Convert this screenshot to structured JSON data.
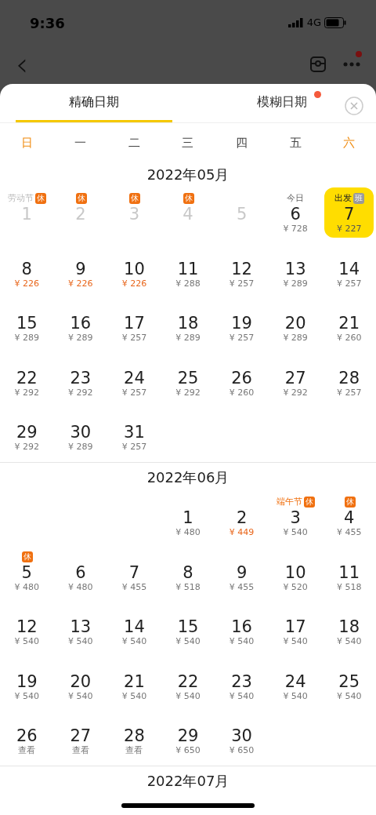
{
  "status_bar": {
    "time": "9:36",
    "network": "4G"
  },
  "nav": {
    "back_icon": "‹",
    "has_notification": true
  },
  "tabs": [
    {
      "label": "精确日期",
      "selected": true,
      "badge": false
    },
    {
      "label": "模糊日期",
      "selected": false,
      "badge": true
    }
  ],
  "weekdays": [
    {
      "label": "日",
      "weekend": true
    },
    {
      "label": "一",
      "weekend": false
    },
    {
      "label": "二",
      "weekend": false
    },
    {
      "label": "三",
      "weekend": false
    },
    {
      "label": "四",
      "weekend": false
    },
    {
      "label": "五",
      "weekend": false
    },
    {
      "label": "六",
      "weekend": true
    }
  ],
  "months": [
    {
      "title": "2022年05月",
      "weeks": [
        [
          {
            "kind": "day",
            "day": "1",
            "note": "劳动节",
            "tag": {
              "text": "休",
              "kind": "rest"
            },
            "past": true,
            "selected": false
          },
          {
            "kind": "day",
            "day": "2",
            "tag": {
              "text": "休",
              "kind": "rest"
            },
            "past": true,
            "selected": false
          },
          {
            "kind": "day",
            "day": "3",
            "tag": {
              "text": "休",
              "kind": "rest"
            },
            "past": true,
            "selected": false
          },
          {
            "kind": "day",
            "day": "4",
            "tag": {
              "text": "休",
              "kind": "rest"
            },
            "past": true,
            "selected": false
          },
          {
            "kind": "day",
            "day": "5",
            "past": true,
            "selected": false
          },
          {
            "kind": "day",
            "day": "6",
            "note": "今日",
            "price": "¥ 728",
            "past": false,
            "selected": false,
            "cheap": false
          },
          {
            "kind": "day",
            "day": "7",
            "note": "出发",
            "tag": {
              "text": "班",
              "kind": "work"
            },
            "price": "¥ 227",
            "past": false,
            "selected": true,
            "cheap": false
          }
        ],
        [
          {
            "kind": "day",
            "day": "8",
            "price": "¥ 226",
            "past": false,
            "selected": false,
            "cheap": true
          },
          {
            "kind": "day",
            "day": "9",
            "price": "¥ 226",
            "past": false,
            "selected": false,
            "cheap": true
          },
          {
            "kind": "day",
            "day": "10",
            "price": "¥ 226",
            "past": false,
            "selected": false,
            "cheap": true
          },
          {
            "kind": "day",
            "day": "11",
            "price": "¥ 288",
            "past": false,
            "selected": false,
            "cheap": false
          },
          {
            "kind": "day",
            "day": "12",
            "price": "¥ 257",
            "past": false,
            "selected": false,
            "cheap": false
          },
          {
            "kind": "day",
            "day": "13",
            "price": "¥ 289",
            "past": false,
            "selected": false,
            "cheap": false
          },
          {
            "kind": "day",
            "day": "14",
            "price": "¥ 257",
            "past": false,
            "selected": false,
            "cheap": false
          }
        ],
        [
          {
            "kind": "day",
            "day": "15",
            "price": "¥ 289",
            "past": false,
            "selected": false,
            "cheap": false
          },
          {
            "kind": "day",
            "day": "16",
            "price": "¥ 289",
            "past": false,
            "selected": false,
            "cheap": false
          },
          {
            "kind": "day",
            "day": "17",
            "price": "¥ 257",
            "past": false,
            "selected": false,
            "cheap": false
          },
          {
            "kind": "day",
            "day": "18",
            "price": "¥ 289",
            "past": false,
            "selected": false,
            "cheap": false
          },
          {
            "kind": "day",
            "day": "19",
            "price": "¥ 257",
            "past": false,
            "selected": false,
            "cheap": false
          },
          {
            "kind": "day",
            "day": "20",
            "price": "¥ 289",
            "past": false,
            "selected": false,
            "cheap": false
          },
          {
            "kind": "day",
            "day": "21",
            "price": "¥ 260",
            "past": false,
            "selected": false,
            "cheap": false
          }
        ],
        [
          {
            "kind": "day",
            "day": "22",
            "price": "¥ 292",
            "past": false,
            "selected": false,
            "cheap": false
          },
          {
            "kind": "day",
            "day": "23",
            "price": "¥ 292",
            "past": false,
            "selected": false,
            "cheap": false
          },
          {
            "kind": "day",
            "day": "24",
            "price": "¥ 257",
            "past": false,
            "selected": false,
            "cheap": false
          },
          {
            "kind": "day",
            "day": "25",
            "price": "¥ 292",
            "past": false,
            "selected": false,
            "cheap": false
          },
          {
            "kind": "day",
            "day": "26",
            "price": "¥ 260",
            "past": false,
            "selected": false,
            "cheap": false
          },
          {
            "kind": "day",
            "day": "27",
            "price": "¥ 292",
            "past": false,
            "selected": false,
            "cheap": false
          },
          {
            "kind": "day",
            "day": "28",
            "price": "¥ 257",
            "past": false,
            "selected": false,
            "cheap": false
          }
        ],
        [
          {
            "kind": "day",
            "day": "29",
            "price": "¥ 292",
            "past": false,
            "selected": false,
            "cheap": false
          },
          {
            "kind": "day",
            "day": "30",
            "price": "¥ 289",
            "past": false,
            "selected": false,
            "cheap": false
          },
          {
            "kind": "day",
            "day": "31",
            "price": "¥ 257",
            "past": false,
            "selected": false,
            "cheap": false
          }
        ]
      ]
    },
    {
      "title": "2022年06月",
      "weeks": [
        [
          {
            "kind": "empty"
          },
          {
            "kind": "empty"
          },
          {
            "kind": "empty"
          },
          {
            "kind": "day",
            "day": "1",
            "price": "¥ 480",
            "past": false,
            "selected": false,
            "cheap": false
          },
          {
            "kind": "day",
            "day": "2",
            "price": "¥ 449",
            "past": false,
            "selected": false,
            "cheap": true
          },
          {
            "kind": "day",
            "day": "3",
            "note": "端午节",
            "tag": {
              "text": "休",
              "kind": "rest"
            },
            "price": "¥ 540",
            "past": false,
            "selected": false,
            "cheap": false
          },
          {
            "kind": "day",
            "day": "4",
            "tag": {
              "text": "休",
              "kind": "rest"
            },
            "price": "¥ 455",
            "past": false,
            "selected": false,
            "cheap": false
          }
        ],
        [
          {
            "kind": "day",
            "day": "5",
            "tag": {
              "text": "休",
              "kind": "rest"
            },
            "price": "¥ 480",
            "past": false,
            "selected": false,
            "cheap": false
          },
          {
            "kind": "day",
            "day": "6",
            "price": "¥ 480",
            "past": false,
            "selected": false,
            "cheap": false
          },
          {
            "kind": "day",
            "day": "7",
            "price": "¥ 455",
            "past": false,
            "selected": false,
            "cheap": false
          },
          {
            "kind": "day",
            "day": "8",
            "price": "¥ 518",
            "past": false,
            "selected": false,
            "cheap": false
          },
          {
            "kind": "day",
            "day": "9",
            "price": "¥ 455",
            "past": false,
            "selected": false,
            "cheap": false
          },
          {
            "kind": "day",
            "day": "10",
            "price": "¥ 520",
            "past": false,
            "selected": false,
            "cheap": false
          },
          {
            "kind": "day",
            "day": "11",
            "price": "¥ 518",
            "past": false,
            "selected": false,
            "cheap": false
          }
        ],
        [
          {
            "kind": "day",
            "day": "12",
            "price": "¥ 540",
            "past": false,
            "selected": false,
            "cheap": false
          },
          {
            "kind": "day",
            "day": "13",
            "price": "¥ 540",
            "past": false,
            "selected": false,
            "cheap": false
          },
          {
            "kind": "day",
            "day": "14",
            "price": "¥ 540",
            "past": false,
            "selected": false,
            "cheap": false
          },
          {
            "kind": "day",
            "day": "15",
            "price": "¥ 540",
            "past": false,
            "selected": false,
            "cheap": false
          },
          {
            "kind": "day",
            "day": "16",
            "price": "¥ 540",
            "past": false,
            "selected": false,
            "cheap": false
          },
          {
            "kind": "day",
            "day": "17",
            "price": "¥ 540",
            "past": false,
            "selected": false,
            "cheap": false
          },
          {
            "kind": "day",
            "day": "18",
            "price": "¥ 540",
            "past": false,
            "selected": false,
            "cheap": false
          }
        ],
        [
          {
            "kind": "day",
            "day": "19",
            "price": "¥ 540",
            "past": false,
            "selected": false,
            "cheap": false
          },
          {
            "kind": "day",
            "day": "20",
            "price": "¥ 540",
            "past": false,
            "selected": false,
            "cheap": false
          },
          {
            "kind": "day",
            "day": "21",
            "price": "¥ 540",
            "past": false,
            "selected": false,
            "cheap": false
          },
          {
            "kind": "day",
            "day": "22",
            "price": "¥ 540",
            "past": false,
            "selected": false,
            "cheap": false
          },
          {
            "kind": "day",
            "day": "23",
            "price": "¥ 540",
            "past": false,
            "selected": false,
            "cheap": false
          },
          {
            "kind": "day",
            "day": "24",
            "price": "¥ 540",
            "past": false,
            "selected": false,
            "cheap": false
          },
          {
            "kind": "day",
            "day": "25",
            "price": "¥ 540",
            "past": false,
            "selected": false,
            "cheap": false
          }
        ],
        [
          {
            "kind": "day",
            "day": "26",
            "price": "查看",
            "past": false,
            "selected": false,
            "cheap": false
          },
          {
            "kind": "day",
            "day": "27",
            "price": "查看",
            "past": false,
            "selected": false,
            "cheap": false
          },
          {
            "kind": "day",
            "day": "28",
            "price": "查看",
            "past": false,
            "selected": false,
            "cheap": false
          },
          {
            "kind": "day",
            "day": "29",
            "price": "¥ 650",
            "past": false,
            "selected": false,
            "cheap": false
          },
          {
            "kind": "day",
            "day": "30",
            "price": "¥ 650",
            "past": false,
            "selected": false,
            "cheap": false
          }
        ]
      ]
    },
    {
      "title": "2022年07月"
    }
  ]
}
